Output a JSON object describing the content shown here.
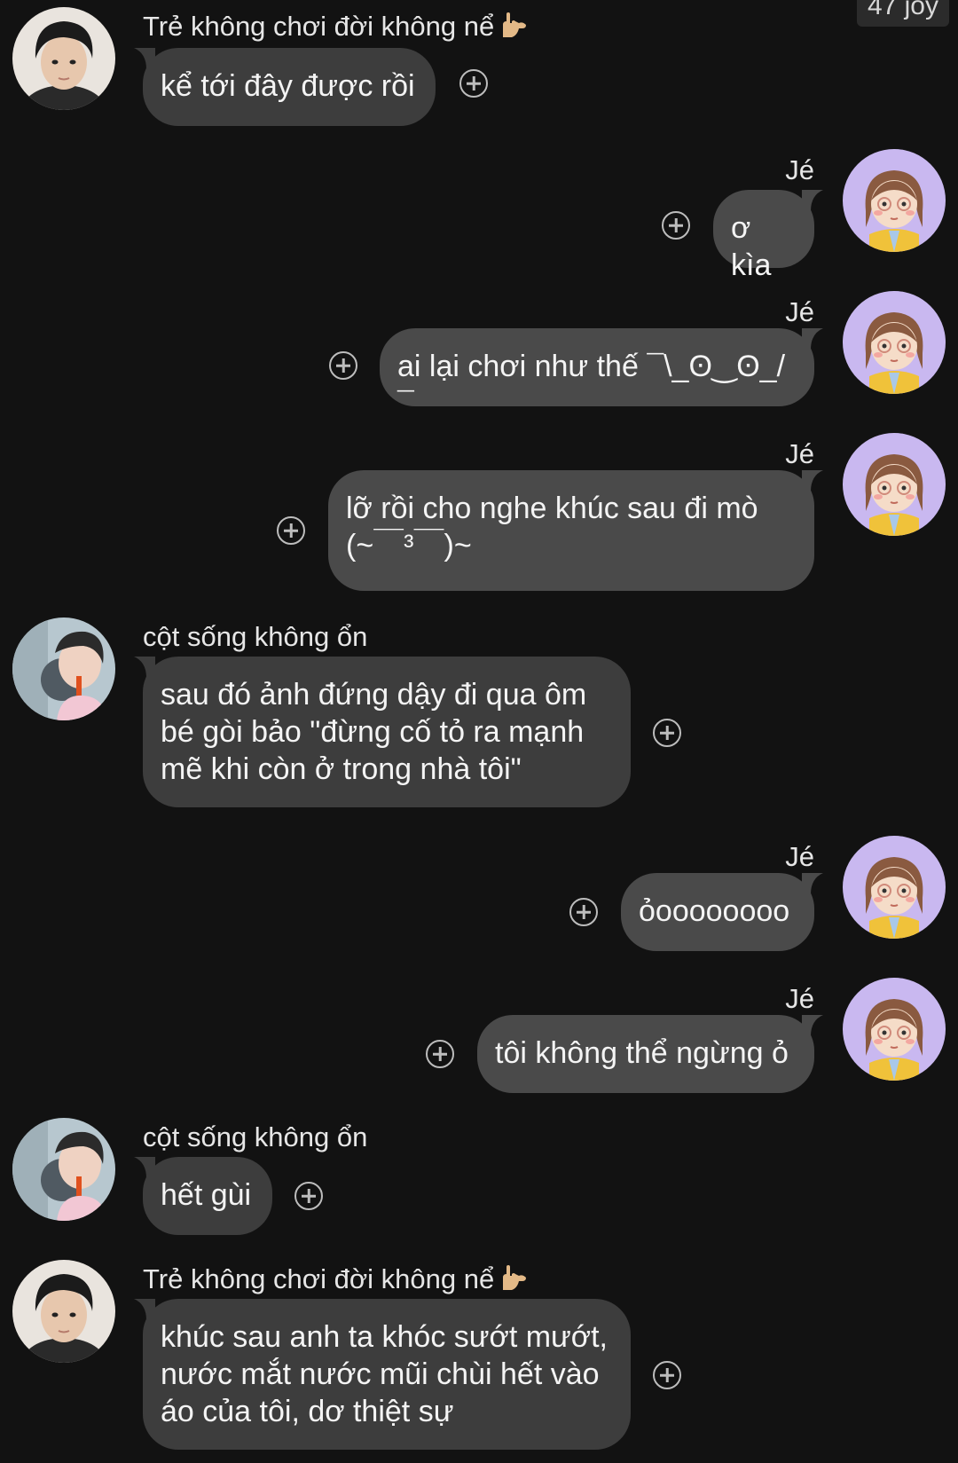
{
  "header": {
    "badge_text": "47 joy"
  },
  "colors": {
    "background": "#121212",
    "bubble_incoming": "#3d3d3d",
    "bubble_outgoing": "#4a4a4a",
    "avatar_je_bg": "#c9b8f0"
  },
  "messages": [
    {
      "side": "left",
      "sender": "Trẻ không chơi đời không nể",
      "sender_emoji": "hand-sign-icon",
      "avatar": "boy-avatar-1",
      "text": "kể tới đây được rồi"
    },
    {
      "side": "right",
      "sender": "Jé",
      "avatar": "girl-cartoon-avatar",
      "text": "ơ kìa"
    },
    {
      "side": "right",
      "sender": "Jé",
      "avatar": "girl-cartoon-avatar",
      "text": "ai lại chơi như thế ¯\\_ʘ‿ʘ_/¯"
    },
    {
      "side": "right",
      "sender": "Jé",
      "avatar": "girl-cartoon-avatar",
      "text": "lỡ rồi cho nghe khúc sau đi mò\n(~￣³￣)~"
    },
    {
      "side": "left",
      "sender": "cột sống không ổn",
      "avatar": "boy-avatar-2",
      "text": "sau đó ảnh đứng dậy đi qua ôm\nbé gòi bảo \"đừng cố tỏ ra mạnh\nmẽ khi còn ở trong nhà tôi\""
    },
    {
      "side": "right",
      "sender": "Jé",
      "avatar": "girl-cartoon-avatar",
      "text": "ỏoooooooo"
    },
    {
      "side": "right",
      "sender": "Jé",
      "avatar": "girl-cartoon-avatar",
      "text": "tôi không thể ngừng ỏ"
    },
    {
      "side": "left",
      "sender": "cột sống không ổn",
      "avatar": "boy-avatar-2",
      "text": "hết gùi"
    },
    {
      "side": "left",
      "sender": "Trẻ không chơi đời không nể",
      "sender_emoji": "hand-sign-icon",
      "avatar": "boy-avatar-1",
      "text": "khúc sau anh ta khóc sướt mướt,\nnước mắt nước mũi chùi hết vào\náo của tôi, dơ thiệt sự"
    }
  ]
}
